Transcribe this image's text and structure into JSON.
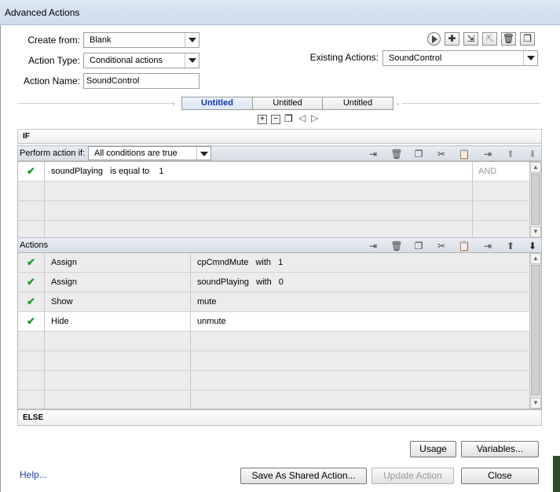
{
  "window": {
    "title": "Advanced Actions"
  },
  "form": {
    "create_from_label": "Create from:",
    "create_from_value": "Blank",
    "action_type_label": "Action Type:",
    "action_type_value": "Conditional actions",
    "action_name_label": "Action Name:",
    "action_name_value": "SoundControl",
    "existing_actions_label": "Existing Actions:",
    "existing_actions_value": "SoundControl"
  },
  "toolbar_top": {
    "icons": [
      "play-icon",
      "add-icon",
      "import-icon",
      "export-icon",
      "delete-icon",
      "duplicate-icon"
    ]
  },
  "decision_tabs": [
    "Untitled",
    "Untitled",
    "Untitled"
  ],
  "if_section": {
    "label": "IF",
    "perform_label": "Perform action if:",
    "condition_mode": "All conditions are true",
    "conditions": [
      {
        "enabled": true,
        "variable": "soundPlaying",
        "operator": "is equal to",
        "value": "1",
        "logic": "AND"
      },
      {
        "enabled": false,
        "variable": "",
        "operator": "",
        "value": "",
        "logic": ""
      },
      {
        "enabled": false,
        "variable": "",
        "operator": "",
        "value": "",
        "logic": ""
      },
      {
        "enabled": false,
        "variable": "",
        "operator": "",
        "value": "",
        "logic": ""
      }
    ]
  },
  "actions_section": {
    "label": "Actions",
    "rows": [
      {
        "enabled": true,
        "action": "Assign",
        "target": "cpCmndMute",
        "with": "with",
        "value": "1"
      },
      {
        "enabled": true,
        "action": "Assign",
        "target": "soundPlaying",
        "with": "with",
        "value": "0"
      },
      {
        "enabled": true,
        "action": "Show",
        "target": "mute",
        "with": "",
        "value": ""
      },
      {
        "enabled": true,
        "action": "Hide",
        "target": "unmute",
        "with": "",
        "value": ""
      },
      {
        "enabled": false,
        "action": "",
        "target": "",
        "with": "",
        "value": ""
      },
      {
        "enabled": false,
        "action": "",
        "target": "",
        "with": "",
        "value": ""
      },
      {
        "enabled": false,
        "action": "",
        "target": "",
        "with": "",
        "value": ""
      },
      {
        "enabled": false,
        "action": "",
        "target": "",
        "with": "",
        "value": ""
      }
    ]
  },
  "else_section": {
    "label": "ELSE"
  },
  "buttons": {
    "usage": "Usage",
    "variables": "Variables...",
    "help": "Help...",
    "save_shared": "Save As Shared Action...",
    "update": "Update Action",
    "close": "Close"
  }
}
